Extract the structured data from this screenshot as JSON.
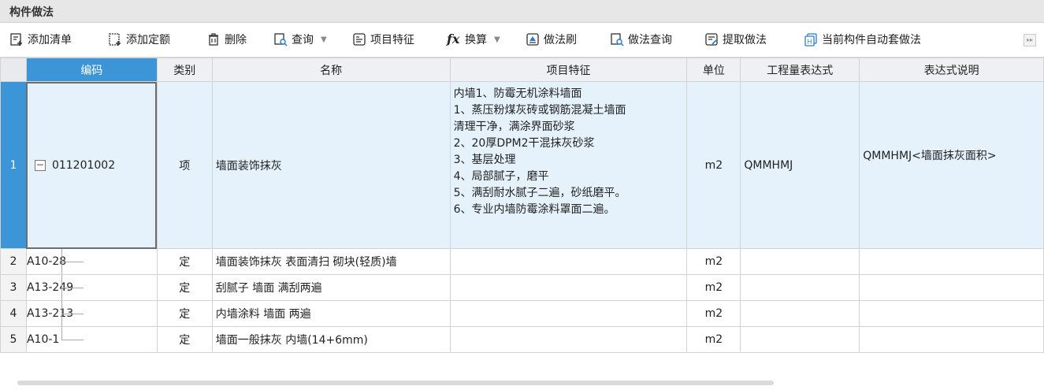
{
  "panel": {
    "title": "构件做法"
  },
  "toolbar": {
    "items": [
      {
        "label": "添加清单",
        "icon": "add-list-icon"
      },
      {
        "label": "添加定额",
        "icon": "add-quota-icon"
      },
      {
        "label": "删除",
        "icon": "trash-icon"
      },
      {
        "label": "查询",
        "icon": "query-icon",
        "dropdown": true
      },
      {
        "label": "项目特征",
        "icon": "feature-icon"
      },
      {
        "label": "换算",
        "icon": "fx-icon",
        "dropdown": true
      },
      {
        "label": "做法刷",
        "icon": "brush-icon"
      },
      {
        "label": "做法查询",
        "icon": "method-query-icon"
      },
      {
        "label": "提取做法",
        "icon": "extract-icon"
      },
      {
        "label": "当前构件自动套做法",
        "icon": "auto-apply-icon"
      }
    ]
  },
  "table": {
    "headers": [
      "编码",
      "类别",
      "名称",
      "项目特征",
      "单位",
      "工程量表达式",
      "表达式说明"
    ],
    "rows": [
      {
        "num": "1",
        "code": "011201002",
        "type": "项",
        "name": "墙面装饰抹灰",
        "features": [
          "内墙1、防霉无机涂料墙面",
          "1、蒸压粉煤灰砖或钢筋混凝土墙面",
          "清理干净，满涂界面砂浆",
          "2、20厚DPM2干混抹灰砂浆",
          "3、基层处理",
          "4、局部腻子，磨平",
          "5、满刮耐水腻子二遍，砂纸磨平。",
          "6、专业内墙防霉涂料罩面二遍。"
        ],
        "unit": "m2",
        "expr": "QMMHMJ",
        "desc": "QMMHMJ<墙面抹灰面积>"
      },
      {
        "num": "2",
        "code": "A10-28",
        "type": "定",
        "name": "墙面装饰抹灰 表面清扫 砌块(轻质)墙",
        "unit": "m2",
        "expr": "",
        "desc": ""
      },
      {
        "num": "3",
        "code": "A13-249",
        "type": "定",
        "name": "刮腻子 墙面 满刮两遍",
        "unit": "m2",
        "expr": "",
        "desc": ""
      },
      {
        "num": "4",
        "code": "A13-213",
        "type": "定",
        "name": "内墙涂料 墙面 两遍",
        "unit": "m2",
        "expr": "",
        "desc": ""
      },
      {
        "num": "5",
        "code": "A10-1",
        "type": "定",
        "name": "墙面一般抹灰 内墙(14+6mm)",
        "unit": "m2",
        "expr": "",
        "desc": ""
      }
    ]
  }
}
